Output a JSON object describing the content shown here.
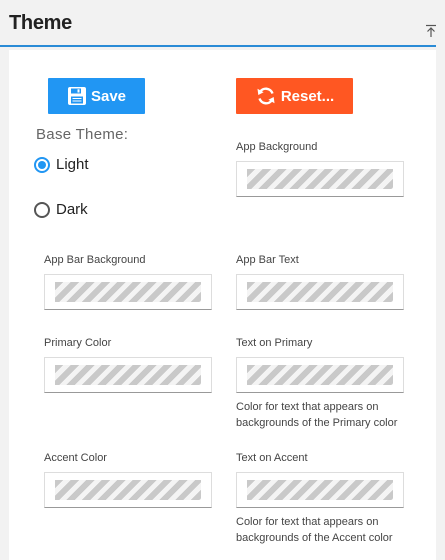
{
  "header": {
    "title": "Theme",
    "collapse_icon": "collapse-up-icon"
  },
  "buttons": {
    "save_label": "Save",
    "save_icon": "floppy-disk-icon",
    "save_color": "#2196f3",
    "reset_label": "Reset...",
    "reset_icon": "refresh-icon",
    "reset_color": "#ff5722"
  },
  "base_theme": {
    "label": "Base Theme:",
    "options": [
      {
        "label": "Light",
        "selected": true
      },
      {
        "label": "Dark",
        "selected": false
      }
    ]
  },
  "fields": {
    "app_background": {
      "label": "App Background"
    },
    "app_bar_background": {
      "label": "App Bar Background"
    },
    "app_bar_text": {
      "label": "App Bar Text"
    },
    "primary_color": {
      "label": "Primary Color"
    },
    "text_on_primary": {
      "label": "Text on Primary",
      "help": "Color for text that appears on backgrounds of the Primary color"
    },
    "accent_color": {
      "label": "Accent Color"
    },
    "text_on_accent": {
      "label": "Text on Accent",
      "help": "Color for text that appears on backgrounds of the Accent color"
    }
  },
  "colors": {
    "accent_rule": "#2a8bd6",
    "radio_selected": "#2196f3"
  }
}
